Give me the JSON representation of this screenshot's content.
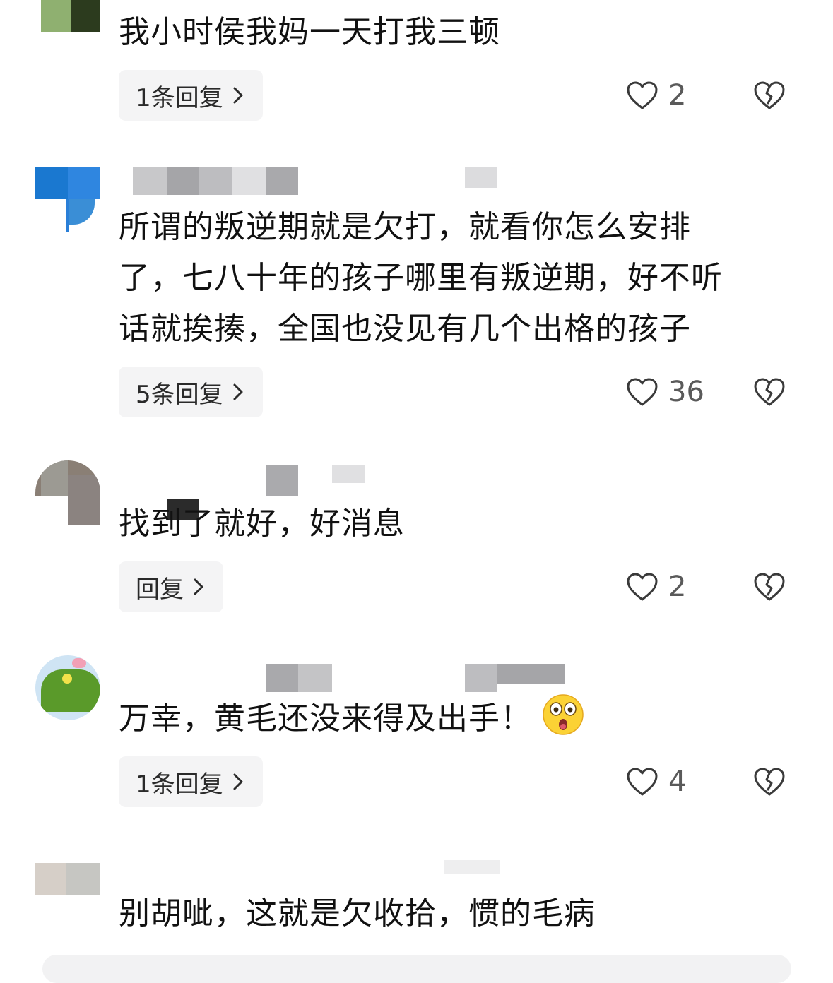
{
  "comments": [
    {
      "text": "我小时侯我妈一天打我三顿",
      "reply_label": "1条回复",
      "likes": "2"
    },
    {
      "text_lines": [
        "所谓的叛逆期就是欠打，就看你怎么安排",
        "了，七八十年的孩子哪里有叛逆期，好不听",
        "话就挨揍，全国也没见有几个出格的孩子"
      ],
      "reply_label": "5条回复",
      "likes": "36"
    },
    {
      "text": "找到了就好，好消息",
      "reply_label": "回复",
      "likes": "2"
    },
    {
      "text": "万幸，黄毛还没来得及出手！",
      "reply_label": "1条回复",
      "likes": "4",
      "emoji": "astonished-face-emoji"
    },
    {
      "text": "别胡呲，这就是欠收拾，惯的毛病"
    }
  ],
  "colors": {
    "reply_bg": "#f4f4f5",
    "icon_stroke": "#3a3a3a",
    "text": "#111111",
    "count": "#5a5a5a"
  }
}
